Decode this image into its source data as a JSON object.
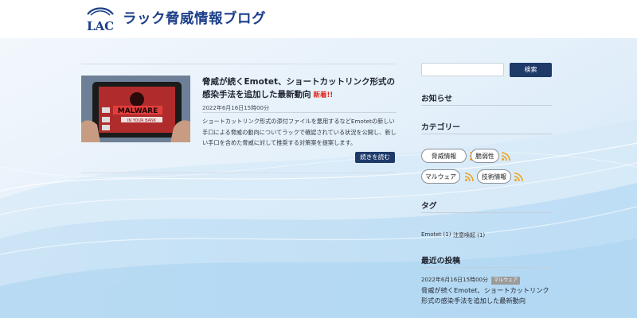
{
  "site": {
    "logo_text": "LAC",
    "title": "ラック脅威情報ブログ"
  },
  "post": {
    "title": "脅威が続くEmotet、ショートカットリンク形式の感染手法を追加した最新動向",
    "new_label": "新着!!",
    "date": "2022年6月16日15時00分",
    "excerpt": "ショートカットリンク形式の添付ファイルを悪用するなどEmotetの新しい手口による脅威の動向についてラックで確認されている状況を公開し、新しい手口を含めた脅威に対して推奨する対策案を提案します。",
    "read_more": "続きを読む",
    "thumb_text": {
      "malware": "MALWARE",
      "sub": "IN YOUR BANK"
    }
  },
  "sidebar": {
    "search": {
      "placeholder": "",
      "button": "検索"
    },
    "notice_title": "お知らせ",
    "category_title": "カテゴリー",
    "categories": [
      "脅威情報",
      "脆弱性",
      "マルウェア",
      "技術情報"
    ],
    "tags_title": "タグ",
    "tags": [
      "Emotet (1)",
      "注意喚起 (1)"
    ],
    "recent_title": "最近の投稿",
    "recent": {
      "date": "2022年6月16日15時00分",
      "category": "マルウェア",
      "title": "脅威が続くEmotet、ショートカットリンク形式の感染手法を追加した最新動向"
    }
  },
  "colors": {
    "brand": "#1d3f8a",
    "button": "#1d3a69",
    "new": "#e0261d",
    "rss": "#f0a11c"
  }
}
